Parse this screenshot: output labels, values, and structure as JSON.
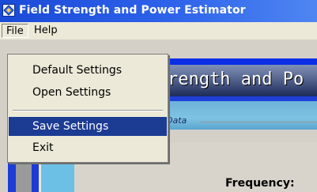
{
  "window": {
    "title": "Field Strength and Power Estimator"
  },
  "menubar": {
    "items": [
      "File",
      "Help"
    ]
  },
  "file_menu": {
    "items": [
      {
        "label": "Default Settings"
      },
      {
        "label": "Open Settings"
      },
      {
        "label": "Save Settings",
        "state": "highlighted"
      },
      {
        "label": "Exit"
      }
    ]
  },
  "main": {
    "banner_text": "rength and Po",
    "group_legend": "Data",
    "frequency_label": "Frequency:"
  },
  "icons": {
    "app": "app-window-icon"
  },
  "colors": {
    "title_bar": "#2f63ea",
    "menu_highlight": "#1c3b93",
    "banner_blue": "#0a2ee6",
    "sky": "#7fc3e2"
  }
}
